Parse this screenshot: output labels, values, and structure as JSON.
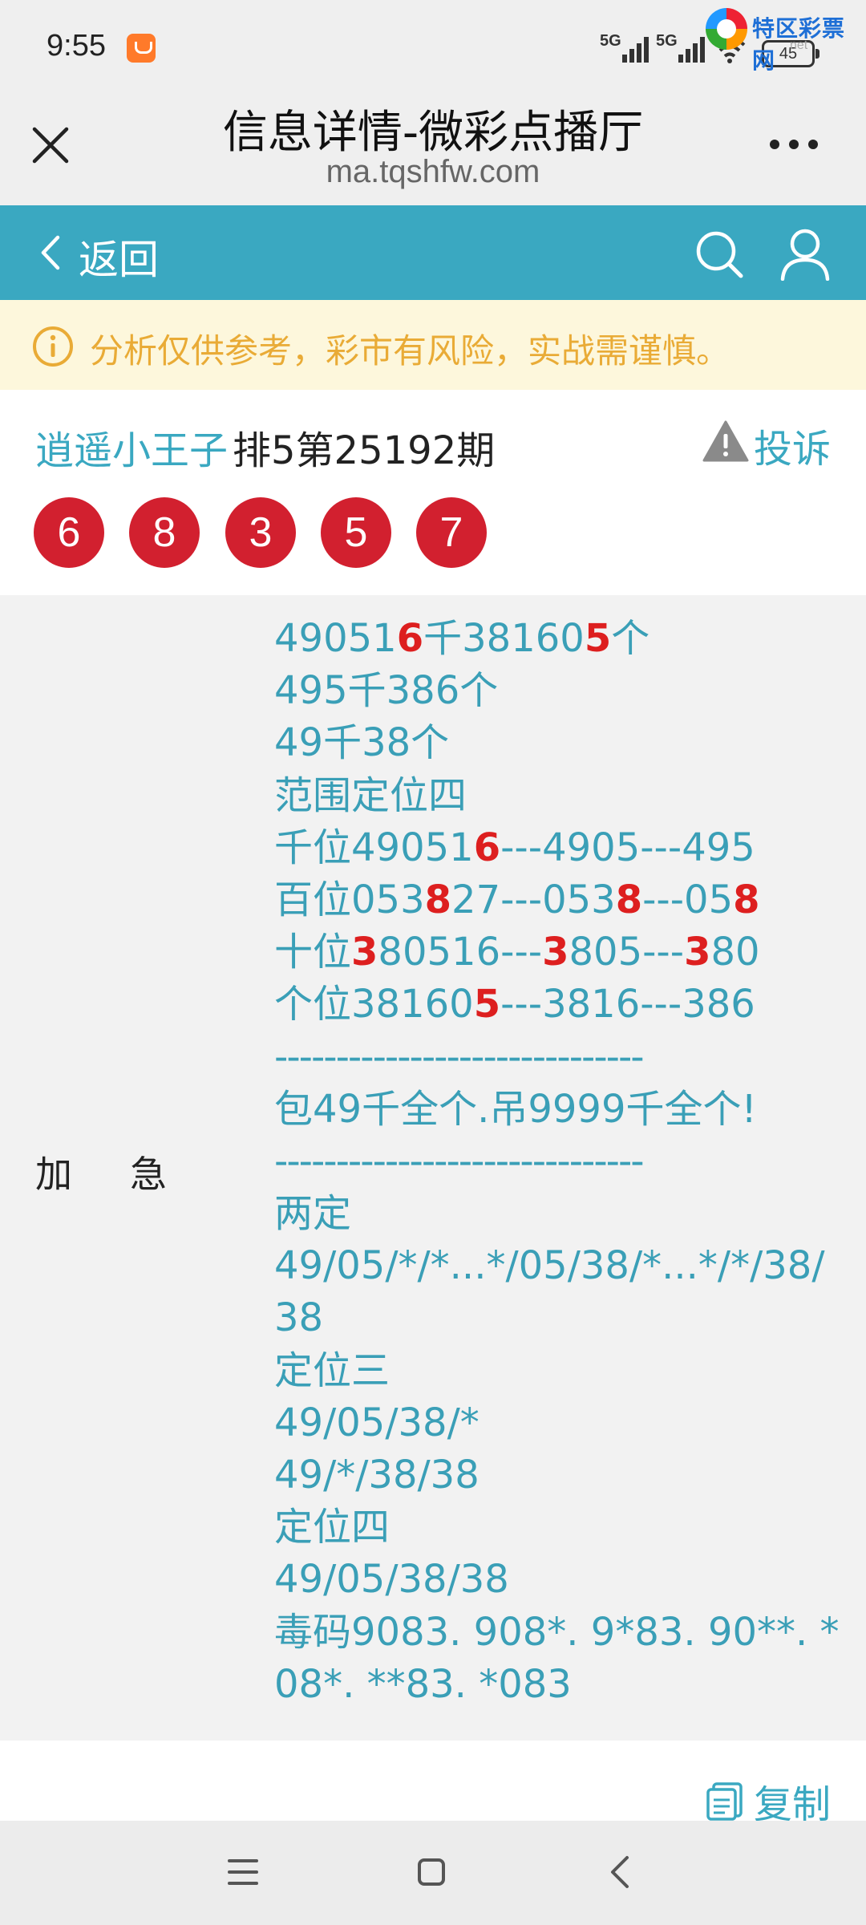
{
  "status_bar": {
    "time": "9:55",
    "network_1": "5G",
    "network_2": "5G",
    "battery": "45",
    "watermark_brand": "特区彩票网",
    "watermark_sub": "net"
  },
  "title_bar": {
    "title": "信息详情-微彩点播厅",
    "url": "ma.tqshfw.com"
  },
  "nav": {
    "back_label": "返回"
  },
  "notice": {
    "text": "分析仅供参考，彩市有风险，实战需谨慎。"
  },
  "post": {
    "author": "逍遥小王子",
    "issue": "排5第25192期",
    "complain_label": "投诉",
    "numbers": [
      "6",
      "8",
      "3",
      "5",
      "7"
    ]
  },
  "content": {
    "label_1": "加",
    "label_2": "急",
    "lines": [
      {
        "segments": [
          {
            "t": "49051",
            "red": false
          },
          {
            "t": "6",
            "red": true
          },
          {
            "t": "千38160",
            "red": false
          },
          {
            "t": "5",
            "red": true
          },
          {
            "t": "个",
            "red": false
          }
        ]
      },
      {
        "segments": [
          {
            "t": "495千386个",
            "red": false
          }
        ]
      },
      {
        "segments": [
          {
            "t": "49千38个",
            "red": false
          }
        ]
      },
      {
        "segments": [
          {
            "t": "范围定位四",
            "red": false
          }
        ]
      },
      {
        "segments": [
          {
            "t": "千位49051",
            "red": false
          },
          {
            "t": "6",
            "red": true
          },
          {
            "t": "---4905---495",
            "red": false
          }
        ]
      },
      {
        "segments": [
          {
            "t": "百位053",
            "red": false
          },
          {
            "t": "8",
            "red": true
          },
          {
            "t": "27---053",
            "red": false
          },
          {
            "t": "8",
            "red": true
          },
          {
            "t": "---05",
            "red": false
          },
          {
            "t": "8",
            "red": true
          }
        ]
      },
      {
        "segments": [
          {
            "t": "十位",
            "red": false
          },
          {
            "t": "3",
            "red": true
          },
          {
            "t": "80516---",
            "red": false
          },
          {
            "t": "3",
            "red": true
          },
          {
            "t": "805---",
            "red": false
          },
          {
            "t": "3",
            "red": true
          },
          {
            "t": "80",
            "red": false
          }
        ]
      },
      {
        "segments": [
          {
            "t": "个位38160",
            "red": false
          },
          {
            "t": "5",
            "red": true
          },
          {
            "t": "---3816---386",
            "red": false
          }
        ]
      },
      {
        "segments": [
          {
            "t": "------------------------------",
            "red": false
          }
        ],
        "sep": true
      },
      {
        "segments": [
          {
            "t": "包49千全个.吊9999千全个!",
            "red": false
          }
        ]
      },
      {
        "segments": [
          {
            "t": "------------------------------",
            "red": false
          }
        ],
        "sep": true
      },
      {
        "segments": [
          {
            "t": "两定",
            "red": false
          }
        ]
      },
      {
        "segments": [
          {
            "t": "49/05/*/*...*/05/38/*...*/*/38/",
            "red": false
          }
        ]
      },
      {
        "segments": [
          {
            "t": "38",
            "red": false
          }
        ]
      },
      {
        "segments": [
          {
            "t": "定位三",
            "red": false
          }
        ]
      },
      {
        "segments": [
          {
            "t": "49/05/38/*",
            "red": false
          }
        ]
      },
      {
        "segments": [
          {
            "t": "49/*/38/38",
            "red": false
          }
        ]
      },
      {
        "segments": [
          {
            "t": "定位四",
            "red": false
          }
        ]
      },
      {
        "segments": [
          {
            "t": "49/05/38/38",
            "red": false
          }
        ]
      },
      {
        "segments": [
          {
            "t": "毒码9083. 908*. 9*83. 90**. *",
            "red": false
          }
        ]
      },
      {
        "segments": [
          {
            "t": "08*. **83. *083",
            "red": false
          }
        ]
      }
    ]
  },
  "copy": {
    "label": "复制"
  },
  "colors": {
    "accent": "#3aa8c1",
    "ball_red": "#d2202f",
    "highlight_red": "#dd1f1f",
    "notice_text": "#e9ab36",
    "notice_bg": "#fdf7dc"
  },
  "icons": [
    "close-icon",
    "more-icon",
    "back-chevron-icon",
    "search-icon",
    "user-icon",
    "info-icon",
    "warning-icon",
    "copy-icon",
    "menu-icon",
    "home-icon",
    "nav-back-icon"
  ]
}
